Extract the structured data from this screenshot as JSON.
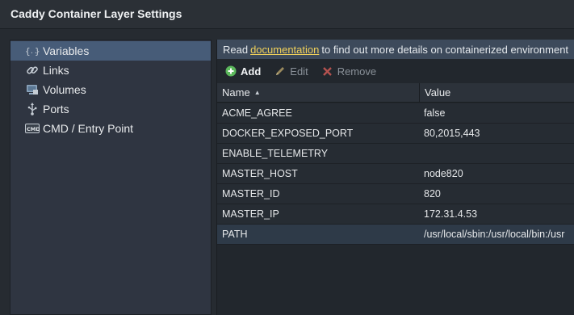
{
  "window": {
    "title": "Caddy Container Layer Settings"
  },
  "sidebar": {
    "items": [
      {
        "label": "Variables",
        "icon": "variables-braces-icon",
        "active": true
      },
      {
        "label": "Links",
        "icon": "link-icon",
        "active": false
      },
      {
        "label": "Volumes",
        "icon": "volumes-icon",
        "active": false
      },
      {
        "label": "Ports",
        "icon": "usb-port-icon",
        "active": false
      },
      {
        "label": "CMD / Entry Point",
        "icon": "cmd-icon",
        "active": false
      }
    ]
  },
  "info": {
    "prefix": "Read",
    "link_text": "documentation",
    "suffix": "to find out more details on containerized environment"
  },
  "toolbar": {
    "add_label": "Add",
    "edit_label": "Edit",
    "remove_label": "Remove"
  },
  "grid": {
    "columns": {
      "name": "Name",
      "value": "Value"
    },
    "sort": "ascending",
    "rows": [
      {
        "name": "ACME_AGREE",
        "value": "false"
      },
      {
        "name": "DOCKER_EXPOSED_PORT",
        "value": "80,2015,443"
      },
      {
        "name": "ENABLE_TELEMETRY",
        "value": ""
      },
      {
        "name": "MASTER_HOST",
        "value": "node820"
      },
      {
        "name": "MASTER_ID",
        "value": "820"
      },
      {
        "name": "MASTER_IP",
        "value": "172.31.4.53"
      },
      {
        "name": "PATH",
        "value": "/usr/local/sbin:/usr/local/bin:/usr"
      }
    ]
  },
  "colors": {
    "accent": "#475c78",
    "link": "#f1d15a",
    "add_green": "#5cb85c",
    "remove_red": "#d9534f"
  }
}
